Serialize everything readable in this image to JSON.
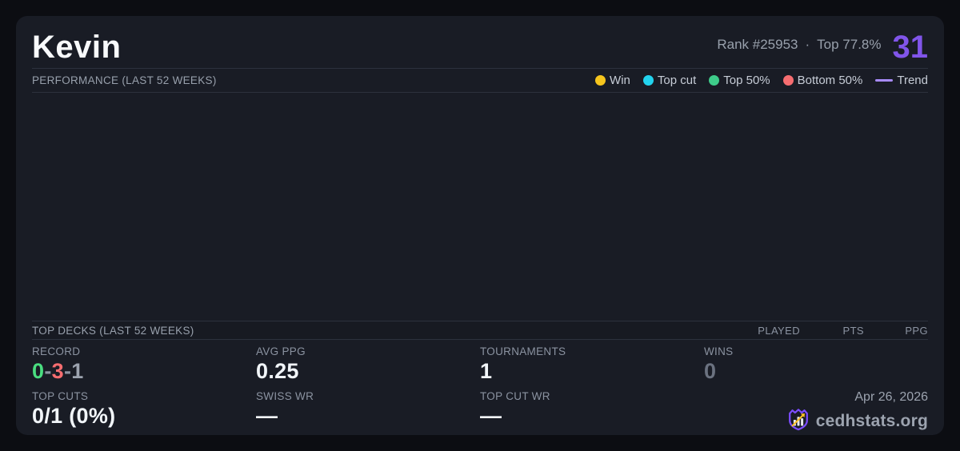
{
  "player": {
    "name": "Kevin",
    "rank_text": "Rank #25953",
    "separator": "·",
    "top_percent_text": "Top 77.8%",
    "score": "31",
    "score_color": "#8155ea"
  },
  "performance": {
    "title": "PERFORMANCE (LAST 52 WEEKS)",
    "chart_empty": true,
    "legend": [
      {
        "label": "Win",
        "color": "#f6c51d",
        "marker": "dot"
      },
      {
        "label": "Top cut",
        "color": "#22d3ee",
        "marker": "dot"
      },
      {
        "label": "Top 50%",
        "color": "#3ecc8a",
        "marker": "dot"
      },
      {
        "label": "Bottom 50%",
        "color": "#f66d70",
        "marker": "dot"
      },
      {
        "label": "Trend",
        "color": "#a78bfa",
        "marker": "line"
      }
    ]
  },
  "top_decks": {
    "title": "TOP DECKS (LAST 52 WEEKS)",
    "columns": {
      "played": "PLAYED",
      "pts": "PTS",
      "ppg": "PPG"
    },
    "rows": []
  },
  "stats": {
    "record_label": "RECORD",
    "record": {
      "wins": "0",
      "sep1": "-",
      "losses": "3",
      "sep2": "-",
      "draws": "1"
    },
    "record_colors": {
      "wins": "#4ade80",
      "losses": "#f66d70",
      "draws": "#9ca3af"
    },
    "avg_ppg_label": "AVG PPG",
    "avg_ppg": "0.25",
    "tournaments_label": "TOURNAMENTS",
    "tournaments": "1",
    "wins_label": "WINS",
    "wins": "0",
    "top_cuts_label": "TOP CUTS",
    "top_cuts": "0/1 (0%)",
    "swiss_wr_label": "SWISS WR",
    "swiss_wr": "—",
    "top_cut_wr_label": "TOP CUT WR",
    "top_cut_wr": "—"
  },
  "footer": {
    "date": "Apr 26, 2026",
    "brand": "cedhstats.org"
  }
}
